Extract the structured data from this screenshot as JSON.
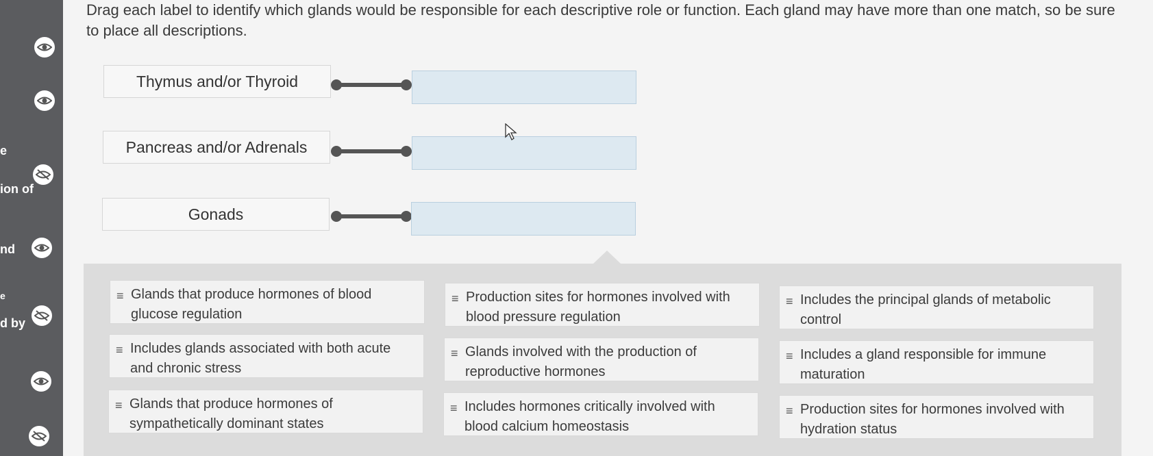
{
  "sidebar": {
    "text_fragments": [
      "e",
      "ion of",
      "nd",
      "e",
      "d by"
    ]
  },
  "instructions": "Drag each label to identify which glands would be responsible for each descriptive role or function. Each gland may have more than one match, so be sure to place all descriptions.",
  "glands": [
    {
      "label": "Thymus and/or Thyroid"
    },
    {
      "label": "Pancreas and/or Adrenals"
    },
    {
      "label": "Gonads"
    }
  ],
  "descriptions": [
    {
      "grip": "≡",
      "text": "Glands that produce hormones of blood glucose regulation"
    },
    {
      "grip": "≡",
      "text": "Production sites for hormones involved with blood pressure regulation"
    },
    {
      "grip": "≡",
      "text": "Includes the principal glands of metabolic control"
    },
    {
      "grip": "≡",
      "text": "Includes glands associated with both acute and chronic stress"
    },
    {
      "grip": "≡",
      "text": "Glands involved with the production of reproductive hormones"
    },
    {
      "grip": "≡",
      "text": "Includes a gland responsible for immune maturation"
    },
    {
      "grip": "≡",
      "text": "Glands that produce hormones of sympathetically dominant states"
    },
    {
      "grip": "≡",
      "text": "Includes hormones critically involved with blood calcium homeostasis"
    },
    {
      "grip": "≡",
      "text": "Production sites for hormones involved with hydration status"
    }
  ],
  "colors": {
    "sidebar": "#5b5c5f",
    "dropzone": "#dde9f1",
    "connector": "#555555"
  }
}
